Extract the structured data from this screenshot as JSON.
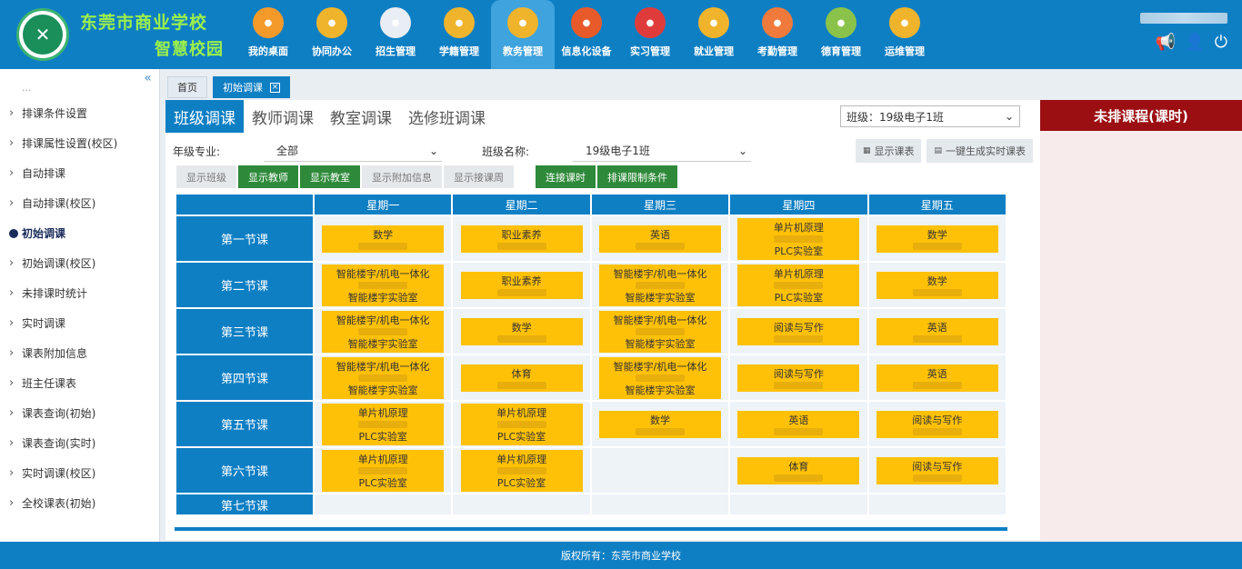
{
  "header": {
    "school_name": "东莞市商业学校",
    "campus_name": "智慧校园",
    "modules": [
      {
        "label": "我的桌面",
        "icon": "desktop-grid-icon",
        "color": "#f39a2b"
      },
      {
        "label": "协同办公",
        "icon": "office-monitor-icon",
        "color": "#f0b42c"
      },
      {
        "label": "招生管理",
        "icon": "student-icon",
        "color": "#e8eef4"
      },
      {
        "label": "学籍管理",
        "icon": "student-record-icon",
        "color": "#f0b42c"
      },
      {
        "label": "教务管理",
        "icon": "academic-icon",
        "color": "#f0b42c"
      },
      {
        "label": "信息化设备",
        "icon": "device-icon",
        "color": "#e85a2a"
      },
      {
        "label": "实习管理",
        "icon": "internship-icon",
        "color": "#e03b3b"
      },
      {
        "label": "就业管理",
        "icon": "employment-icon",
        "color": "#f0b42c"
      },
      {
        "label": "考勤管理",
        "icon": "attendance-icon",
        "color": "#f07a3b"
      },
      {
        "label": "德育管理",
        "icon": "moral-education-icon",
        "color": "#8bc34a"
      },
      {
        "label": "运维管理",
        "icon": "maintenance-icon",
        "color": "#f0b42c"
      }
    ],
    "active_module_index": 4
  },
  "sidebar": {
    "items": [
      {
        "label": "排课条件设置"
      },
      {
        "label": "排课属性设置(校区)"
      },
      {
        "label": "自动排课"
      },
      {
        "label": "自动排课(校区)"
      },
      {
        "label": "初始调课",
        "active": true
      },
      {
        "label": "初始调课(校区)"
      },
      {
        "label": "未排课时统计"
      },
      {
        "label": "实时调课"
      },
      {
        "label": "课表附加信息"
      },
      {
        "label": "班主任课表"
      },
      {
        "label": "课表查询(初始)"
      },
      {
        "label": "课表查询(实时)"
      },
      {
        "label": "实时调课(校区)"
      },
      {
        "label": "全校课表(初始)"
      }
    ]
  },
  "tabs": {
    "home": "首页",
    "current": "初始调课"
  },
  "view_tabs": [
    "班级调课",
    "教师调课",
    "教室调课",
    "选修班调课"
  ],
  "class_select": "班级：19级电子1班",
  "filters": {
    "grade_label": "年级专业:",
    "grade_value": "全部",
    "class_label": "班级名称:",
    "class_value": "19级电子1班",
    "show_schedule": "显示课表",
    "generate_realtime": "一键生成实时课表"
  },
  "option_buttons": [
    {
      "label": "显示班级",
      "on": false
    },
    {
      "label": "显示教师",
      "on": true
    },
    {
      "label": "显示教室",
      "on": true
    },
    {
      "label": "显示附加信息",
      "on": false
    },
    {
      "label": "显示接课周",
      "on": false
    }
  ],
  "action_buttons": [
    "连接课时",
    "排课限制条件"
  ],
  "schedule": {
    "days": [
      "星期一",
      "星期二",
      "星期三",
      "星期四",
      "星期五"
    ],
    "periods": [
      {
        "label": "第一节课",
        "cells": [
          {
            "name": "数学"
          },
          {
            "name": "职业素养"
          },
          {
            "name": "英语"
          },
          {
            "name": "单片机原理",
            "room": "PLC实验室"
          },
          {
            "name": "数学"
          }
        ]
      },
      {
        "label": "第二节课",
        "cells": [
          {
            "name": "智能楼宇/机电一体化",
            "room": "智能楼宇实验室"
          },
          {
            "name": "职业素养"
          },
          {
            "name": "智能楼宇/机电一体化",
            "room": "智能楼宇实验室"
          },
          {
            "name": "单片机原理",
            "room": "PLC实验室"
          },
          {
            "name": "数学"
          }
        ]
      },
      {
        "label": "第三节课",
        "cells": [
          {
            "name": "智能楼宇/机电一体化",
            "room": "智能楼宇实验室"
          },
          {
            "name": "数学"
          },
          {
            "name": "智能楼宇/机电一体化",
            "room": "智能楼宇实验室"
          },
          {
            "name": "阅读与写作"
          },
          {
            "name": "英语"
          }
        ]
      },
      {
        "label": "第四节课",
        "cells": [
          {
            "name": "智能楼宇/机电一体化",
            "room": "智能楼宇实验室"
          },
          {
            "name": "体育"
          },
          {
            "name": "智能楼宇/机电一体化",
            "room": "智能楼宇实验室"
          },
          {
            "name": "阅读与写作"
          },
          {
            "name": "英语"
          }
        ]
      },
      {
        "label": "第五节课",
        "cells": [
          {
            "name": "单片机原理",
            "room": "PLC实验室"
          },
          {
            "name": "单片机原理",
            "room": "PLC实验室"
          },
          {
            "name": "数学"
          },
          {
            "name": "英语"
          },
          {
            "name": "阅读与写作"
          }
        ]
      },
      {
        "label": "第六节课",
        "cells": [
          {
            "name": "单片机原理",
            "room": "PLC实验室"
          },
          {
            "name": "单片机原理",
            "room": "PLC实验室"
          },
          null,
          {
            "name": "体育"
          },
          {
            "name": "阅读与写作"
          }
        ]
      },
      {
        "label": "第七节课",
        "cells": [
          null,
          null,
          null,
          null,
          null
        ]
      }
    ]
  },
  "right_panel": {
    "title": "未排课程(课时)"
  },
  "footer": {
    "copyright": "版权所有：东莞市商业学校"
  }
}
